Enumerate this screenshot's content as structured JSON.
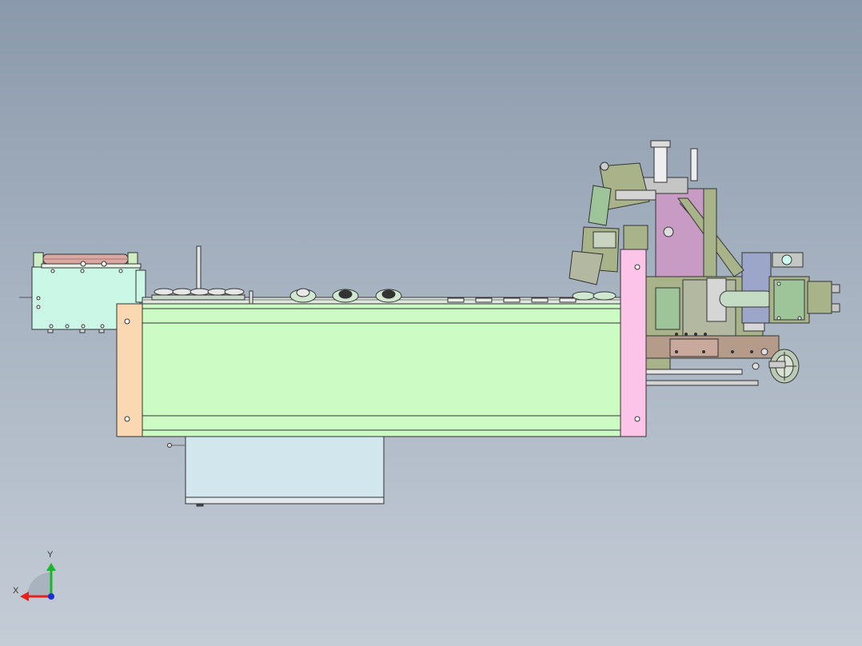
{
  "viewport": {
    "background_top": "#8a99ab",
    "background_bottom": "#c4ccd6"
  },
  "model": {
    "colors": {
      "main_frame": "#ccfcc4",
      "left_end_plate": "#fad9b2",
      "right_end_plate": "#fcc4e8",
      "bottom_box": "#d2e6ee",
      "feeder_box": "#cbf8e6",
      "roller": "#d9a8a0",
      "head_plate": "#c79bc3",
      "head_olive": "#a8b38a",
      "head_green": "#9ec59a",
      "edge": "#333333"
    },
    "parts": [
      "feeder-unit",
      "guide-rollers",
      "main-frame",
      "bottom-cabinet",
      "processing-head",
      "pneumatic-cylinder",
      "handwheel"
    ]
  },
  "triad": {
    "x_label": "X",
    "y_label": "Y",
    "x_color": "#e0241c",
    "y_color": "#19b82a",
    "z_color": "#1a2fd6"
  }
}
